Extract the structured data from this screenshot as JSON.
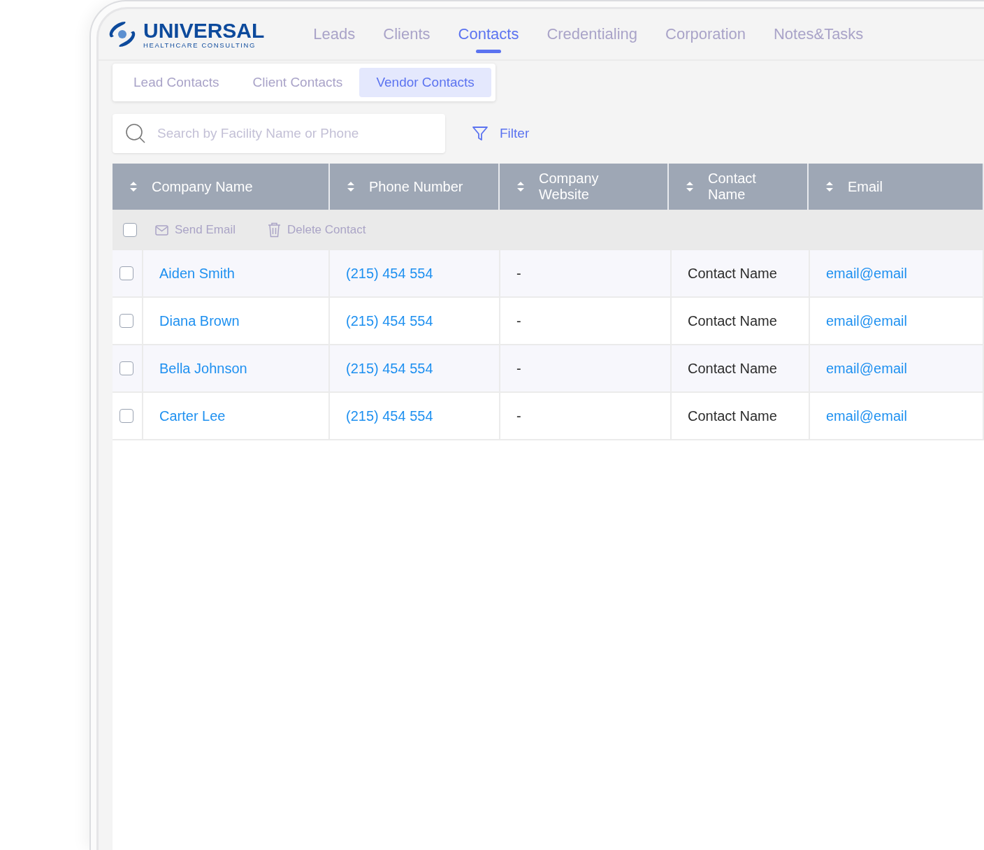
{
  "logo": {
    "title": "UNIVERSAL",
    "subtitle": "HEALTHCARE CONSULTING"
  },
  "nav": [
    {
      "label": "Leads",
      "selected": false
    },
    {
      "label": "Clients",
      "selected": false
    },
    {
      "label": "Contacts",
      "selected": true
    },
    {
      "label": "Credentialing",
      "selected": false
    },
    {
      "label": "Corporation",
      "selected": false
    },
    {
      "label": "Notes&Tasks",
      "selected": false
    }
  ],
  "subtabs": [
    {
      "label": "Lead Contacts",
      "selected": false
    },
    {
      "label": "Client Contacts",
      "selected": false
    },
    {
      "label": "Vendor Contacts",
      "selected": true
    }
  ],
  "search": {
    "placeholder": "Search by Facility Name or Phone"
  },
  "filter": {
    "label": "Filter"
  },
  "table": {
    "columns": [
      "Company Name",
      "Phone Number",
      "Company Website",
      "Contact Name",
      "Email"
    ],
    "bulk": {
      "checked": false,
      "actions": [
        {
          "kind": "email",
          "label": "Send Email"
        },
        {
          "kind": "delete",
          "label": "Delete Contact"
        }
      ]
    },
    "rows": [
      {
        "checked": false,
        "company": "Aiden Smith",
        "phone": "(215) 454 554",
        "website": "-",
        "contact": "Contact Name",
        "email": "email@email"
      },
      {
        "checked": false,
        "company": "Diana Brown",
        "phone": "(215) 454 554",
        "website": "-",
        "contact": "Contact Name",
        "email": "email@email"
      },
      {
        "checked": false,
        "company": "Bella Johnson",
        "phone": "(215) 454 554",
        "website": "-",
        "contact": "Contact Name",
        "email": "email@email"
      },
      {
        "checked": false,
        "company": "Carter Lee",
        "phone": "(215) 454 554",
        "website": "-",
        "contact": "Contact Name",
        "email": "email@email"
      }
    ]
  }
}
